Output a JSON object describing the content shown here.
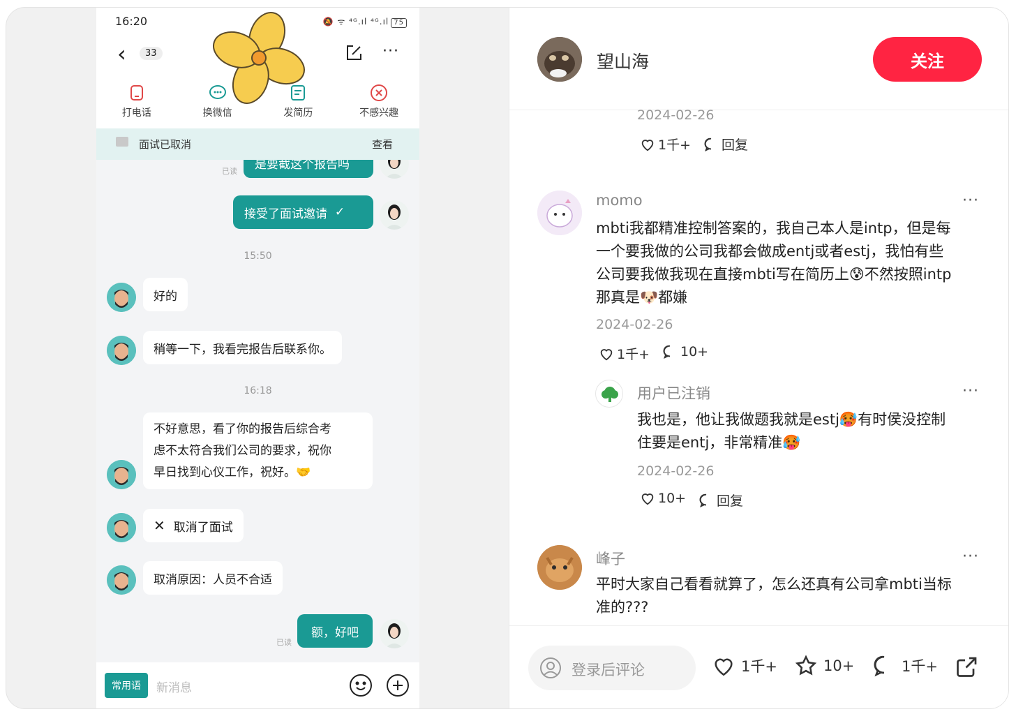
{
  "chat": {
    "status_time": "16:20",
    "status_icons": "🔕 ᯤ ⁴ᴳ.ıl ⁴ᴳ.ıl",
    "battery": "75",
    "unread_badge": "33",
    "actions": [
      {
        "label": "打电话",
        "icon": "phone-icon"
      },
      {
        "label": "换微信",
        "icon": "wechat-icon"
      },
      {
        "label": "发简历",
        "icon": "resume-icon"
      },
      {
        "label": "不感兴趣",
        "icon": "not-interested-icon"
      }
    ],
    "cancel_banner": {
      "text": "面试已取消",
      "view": "查看"
    },
    "partial_top": {
      "text": "是要截这个报告吗",
      "read": "已读"
    },
    "accepted": {
      "text": "接受了面试邀请",
      "check": "✓"
    },
    "stamp1": "15:50",
    "msg_ok": "好的",
    "msg_wait": "稍等一下，我看完报告后联系你。",
    "stamp2": "16:18",
    "msg_reject": [
      "不好意思，看了你的报告后综合考",
      "虑不太符合我们公司的要求，祝你",
      "早日找到心仪工作，祝好。🤝"
    ],
    "msg_cancel_icon": "✕",
    "msg_cancel": "取消了面试",
    "msg_reason": "取消原因：人员不合适",
    "msg_final": "额，好吧",
    "read_label": "已读",
    "common_phrases": "常用语",
    "new_message_placeholder": "新消息"
  },
  "panel": {
    "author": "望山海",
    "follow": "关注",
    "top_comment": {
      "date": "2024-02-26",
      "likes": "1千+",
      "reply": "回复"
    },
    "comments": [
      {
        "name": "momo",
        "lines": [
          "mbti我都精准控制答案的，我自己本人是intp，但是每",
          "一个要我做的公司我都会做成entj或者estj，我怕有些",
          "公司要我做我现在直接mbti写在简历上😰不然按照intp",
          "那真是🐶都嫌"
        ],
        "date": "2024-02-26",
        "likes": "1千+",
        "replies": "10+"
      },
      {
        "name": "用户已注销",
        "lines": [
          "我也是，他让我做题我就是estj🥵有时侯没控制",
          "住要是entj，非常精准🥵"
        ],
        "date": "2024-02-26",
        "likes": "10+",
        "reply": "回复"
      },
      {
        "name": "峰子",
        "lines": [
          "平时大家自己看看就算了，怎么还真有公司拿mbti当标",
          "准的???"
        ]
      }
    ],
    "more": "···",
    "footer": {
      "placeholder": "登录后评论",
      "likes": "1千+",
      "stars": "10+",
      "comments": "1千+"
    }
  }
}
